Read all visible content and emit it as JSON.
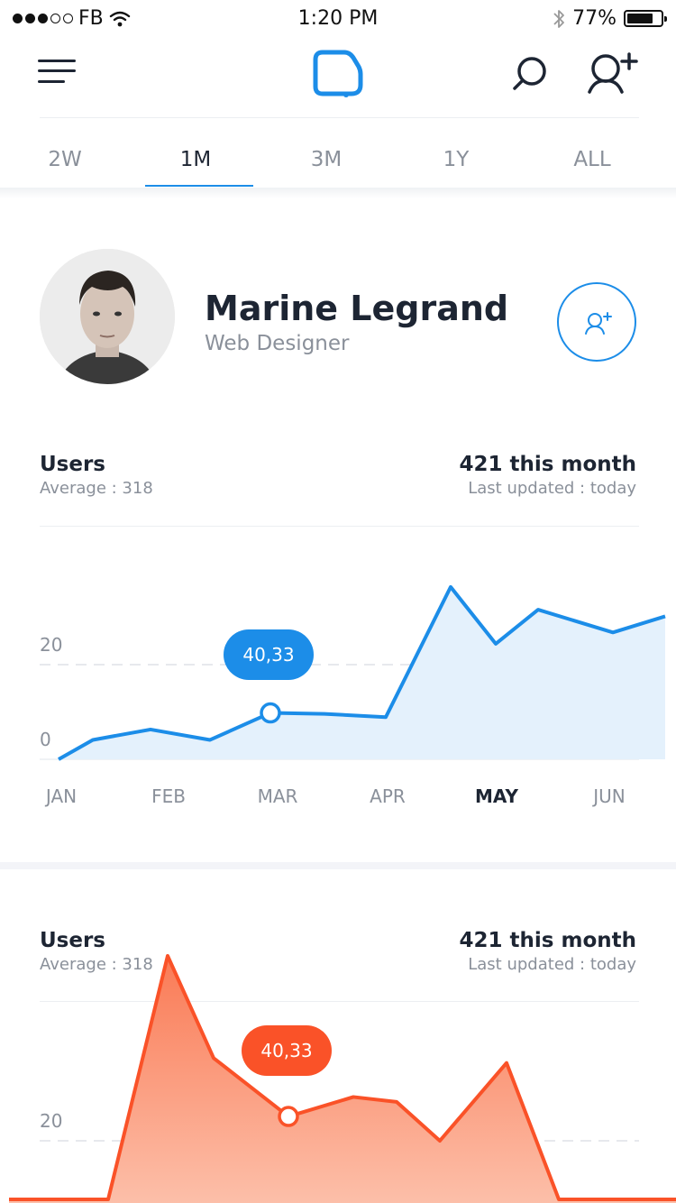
{
  "status_bar": {
    "carrier": "FB",
    "time": "1:20 PM",
    "battery_text": "77%",
    "battery_level": 0.77
  },
  "nav": {
    "menu_icon": "hamburger-icon",
    "logo_icon": "app-logo-icon",
    "search_icon": "search-icon",
    "add_user_icon": "add-user-icon"
  },
  "tabs": [
    {
      "label": "2W",
      "active": false
    },
    {
      "label": "1M",
      "active": true
    },
    {
      "label": "3M",
      "active": false
    },
    {
      "label": "1Y",
      "active": false
    },
    {
      "label": "ALL",
      "active": false
    }
  ],
  "profile": {
    "name": "Marine Legrand",
    "role": "Web Designer"
  },
  "cards": [
    {
      "title": "Users",
      "average": "Average : 318",
      "total": "421 this month",
      "updated": "Last updated : today",
      "y_labels": [
        "20",
        "0"
      ],
      "months": [
        "JAN",
        "FEB",
        "MAR",
        "APR",
        "MAY",
        "JUN"
      ],
      "active_month": "MAY",
      "badge": "40,33"
    },
    {
      "title": "Users",
      "average": "Average : 318",
      "total": "421 this month",
      "updated": "Last updated : today",
      "y_labels": [
        "20"
      ],
      "badge": "40,33"
    }
  ],
  "chart_data": [
    {
      "type": "area",
      "color": "#1c8de8",
      "x": [
        "JAN",
        "",
        "FEB",
        "",
        "MAR",
        "",
        "APR",
        "",
        "MAY",
        "",
        "",
        "JUN",
        ""
      ],
      "values": [
        0,
        4.1,
        6.3,
        4.1,
        9.8,
        9.6,
        8.9,
        36.4,
        24.4,
        31.6,
        26.8,
        30.2,
        38.2
      ],
      "ylim": [
        0,
        40
      ],
      "highlight": {
        "index": 4,
        "label": "40,33"
      }
    },
    {
      "type": "area",
      "color": "#fa5228",
      "values": [
        6,
        4,
        3,
        58,
        37,
        25,
        29,
        28,
        20,
        36,
        3,
        4,
        5,
        0
      ],
      "highlight": {
        "index": 5,
        "label": "40,33"
      }
    }
  ]
}
